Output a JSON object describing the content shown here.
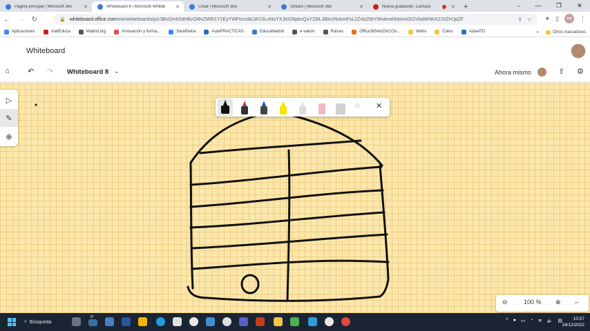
{
  "browser": {
    "tabs": [
      {
        "title": "Página principal | Microsoft 365",
        "active": false,
        "favicon_color": "#3c7bd9"
      },
      {
        "title": "Whiteboard 8 | Microsoft Whiteb",
        "active": true,
        "favicon_color": "#3c7bd9"
      },
      {
        "title": "Crear | Microsoft 365",
        "active": false,
        "favicon_color": "#3c7bd9"
      },
      {
        "title": "Stream | Microsoft 365",
        "active": false,
        "favicon_color": "#3c7bd9"
      },
      {
        "title": "Nueva grabación: Cámara",
        "active": false,
        "favicon_color": "#c5221f"
      }
    ],
    "url_host": "whiteboard.office.com",
    "url_path": "/me/whiteboards/p/c3BvOmh0dHBzOi8vZWR1Y2EyYWFkcmlkLW1SLnNoYXJlcG9pbnQuY29tL3BlcnNvbmFsL2Znb256YWxlemNhbmx0X2VkdWNhX21hZHJpZF"
  },
  "bookmarks": [
    {
      "label": "Aplicaciones",
      "color": "#4285f4"
    },
    {
      "label": "mailEduca",
      "color": "#c5221f"
    },
    {
      "label": "Madrid.org",
      "color": "#555555"
    },
    {
      "label": "Innovación y forma...",
      "color": "#d9534f"
    },
    {
      "label": "SaraReina",
      "color": "#4285f4"
    },
    {
      "label": "AulaPRACTICAS",
      "color": "#2f6db5"
    },
    {
      "label": "EducaMadrid",
      "color": "#3a78c9"
    },
    {
      "label": "e-valúm",
      "color": "#555555"
    },
    {
      "label": "Raíces",
      "color": "#555555"
    },
    {
      "label": "Office365AlcDirCOn...",
      "color": "#e8711a"
    },
    {
      "label": "Webs",
      "color": "#f2c94c"
    },
    {
      "label": "Coles",
      "color": "#f2c94c"
    },
    {
      "label": "AulaATD",
      "color": "#2f6db5"
    }
  ],
  "bookmarks_more": "»",
  "bookmarks_other": "Otros marcadores",
  "app": {
    "title": "Whiteboard",
    "board_name": "Whiteboard 8",
    "save_status": "Ahora mismo",
    "zoom": "100 %"
  },
  "taskbar": {
    "search_label": "Búsqueda",
    "weather": "6°",
    "time": "10:57",
    "date": "24/12/2022"
  },
  "colors": {
    "canvas": "#fbe7ab",
    "grid": "#f0cf85",
    "taskbar": "#1b2433"
  }
}
